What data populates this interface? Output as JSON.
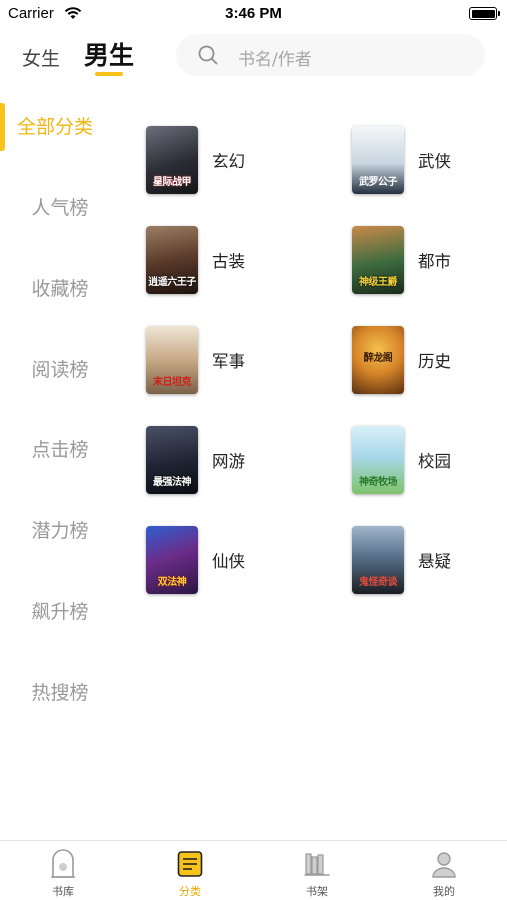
{
  "status_bar": {
    "carrier": "Carrier",
    "time": "3:46 PM"
  },
  "header": {
    "tabs": [
      {
        "label": "女生",
        "selected": false
      },
      {
        "label": "男生",
        "selected": true
      }
    ],
    "search": {
      "placeholder": "书名/作者",
      "icon": "search-icon"
    }
  },
  "sidebar": {
    "items": [
      {
        "label": "全部分类",
        "selected": true
      },
      {
        "label": "人气榜",
        "selected": false
      },
      {
        "label": "收藏榜",
        "selected": false
      },
      {
        "label": "阅读榜",
        "selected": false
      },
      {
        "label": "点击榜",
        "selected": false
      },
      {
        "label": "潜力榜",
        "selected": false
      },
      {
        "label": "飙升榜",
        "selected": false
      },
      {
        "label": "热搜榜",
        "selected": false
      }
    ]
  },
  "categories": [
    {
      "label": "玄幻",
      "cover_text": "星际战甲",
      "cover_color": "#3a3f4a"
    },
    {
      "label": "武侠",
      "cover_text": "武罗公子",
      "cover_color": "#dfe6ec"
    },
    {
      "label": "古装",
      "cover_text": "逍遥六王子",
      "cover_color": "#5a3a2a"
    },
    {
      "label": "都市",
      "cover_text": "神级王爵",
      "cover_color": "#2f5a3a"
    },
    {
      "label": "军事",
      "cover_text": "末日坦克",
      "cover_color": "#d9cbb6"
    },
    {
      "label": "历史",
      "cover_text": "醉龙阁",
      "cover_color": "#d8862a"
    },
    {
      "label": "网游",
      "cover_text": "最强法神",
      "cover_color": "#1f2433"
    },
    {
      "label": "校园",
      "cover_text": "神奇牧场",
      "cover_color": "#a7d7ea"
    },
    {
      "label": "仙侠",
      "cover_text": "双法神",
      "cover_color": "#3b2c5e"
    },
    {
      "label": "悬疑",
      "cover_text": "鬼怪奇谈",
      "cover_color": "#6f8fb0"
    }
  ],
  "tabbar": {
    "items": [
      {
        "label": "书库",
        "icon": "bookstore-icon",
        "selected": false
      },
      {
        "label": "分类",
        "icon": "category-icon",
        "selected": true
      },
      {
        "label": "书架",
        "icon": "bookshelf-icon",
        "selected": false
      },
      {
        "label": "我的",
        "icon": "profile-icon",
        "selected": false
      }
    ]
  },
  "colors": {
    "accent": "#f7c21a",
    "accent_text": "#f0b612",
    "muted": "#9a9a9a"
  }
}
